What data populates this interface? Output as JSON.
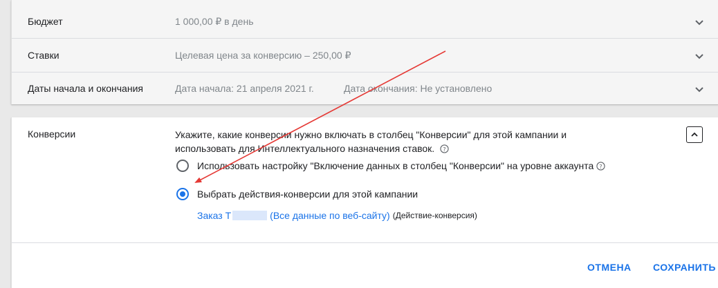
{
  "settings": {
    "budget": {
      "label": "Бюджет",
      "value": "1 000,00 ₽ в день"
    },
    "bids": {
      "label": "Ставки",
      "value": "Целевая цена за конверсию – 250,00 ₽"
    },
    "dates": {
      "label": "Даты начала и окончания",
      "start": "Дата начала: 21 апреля 2021 г.",
      "end": "Дата окончания: Не установлено"
    }
  },
  "conversions": {
    "label": "Конверсии",
    "description": "Укажите, какие конверсии нужно включать в столбец \"Конверсии\" для этой кампании и использовать для Интеллектуального назначения ставок.",
    "options": [
      {
        "label": "Использовать настройку \"Включение данных в столбец \"Конверсии\" на уровне аккаунта",
        "selected": false
      },
      {
        "label": "Выбрать действия-конверсии для этой кампании",
        "selected": true
      }
    ],
    "action": {
      "name_prefix": "Заказ Т",
      "link_suffix": "(Все данные по веб-сайту)",
      "type": "(Действие-конверсия)"
    }
  },
  "buttons": {
    "cancel": "ОТМЕНА",
    "save": "СОХРАНИТЬ"
  },
  "colors": {
    "accent": "#1a73e8",
    "annotation_arrow": "#e53935"
  },
  "icons": [
    "chevron-down-icon",
    "chevron-up-icon",
    "help-icon"
  ]
}
